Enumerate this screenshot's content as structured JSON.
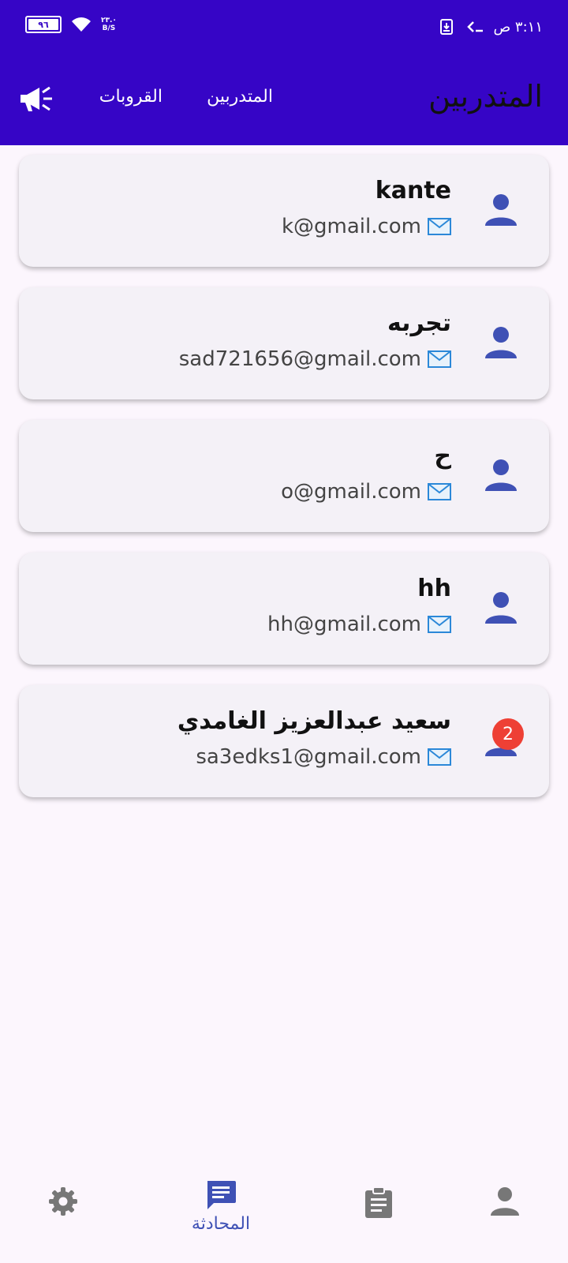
{
  "status_bar": {
    "time": "٣:١١ ص",
    "battery": "٩٦",
    "net_speed_value": "٢٣.٠",
    "net_speed_unit": "B/S"
  },
  "header": {
    "title": "المتدربين",
    "tabs": [
      {
        "label": "المتدربين"
      },
      {
        "label": "القروبات"
      }
    ],
    "background_color": "#3605c6"
  },
  "trainees": [
    {
      "name": "kante",
      "email": "k@gmail.com",
      "badge": ""
    },
    {
      "name": "تجربه",
      "email": "sad721656@gmail.com",
      "badge": ""
    },
    {
      "name": "ح",
      "email": "o@gmail.com",
      "badge": ""
    },
    {
      "name": "hh",
      "email": "hh@gmail.com",
      "badge": ""
    },
    {
      "name": "سعيد عبدالعزيز الغامدي",
      "email": "sa3edks1@gmail.com",
      "badge": "2"
    }
  ],
  "bottom_nav": {
    "items": [
      {
        "icon": "gear-icon",
        "label": ""
      },
      {
        "icon": "chat-icon",
        "label": "المحادثة",
        "active": true
      },
      {
        "icon": "clipboard-icon",
        "label": ""
      },
      {
        "icon": "person-icon",
        "label": ""
      }
    ],
    "active_color": "#3f51b5"
  },
  "colors": {
    "accent": "#3f51b5",
    "badge": "#ee4035",
    "card": "#f4f1f7"
  }
}
